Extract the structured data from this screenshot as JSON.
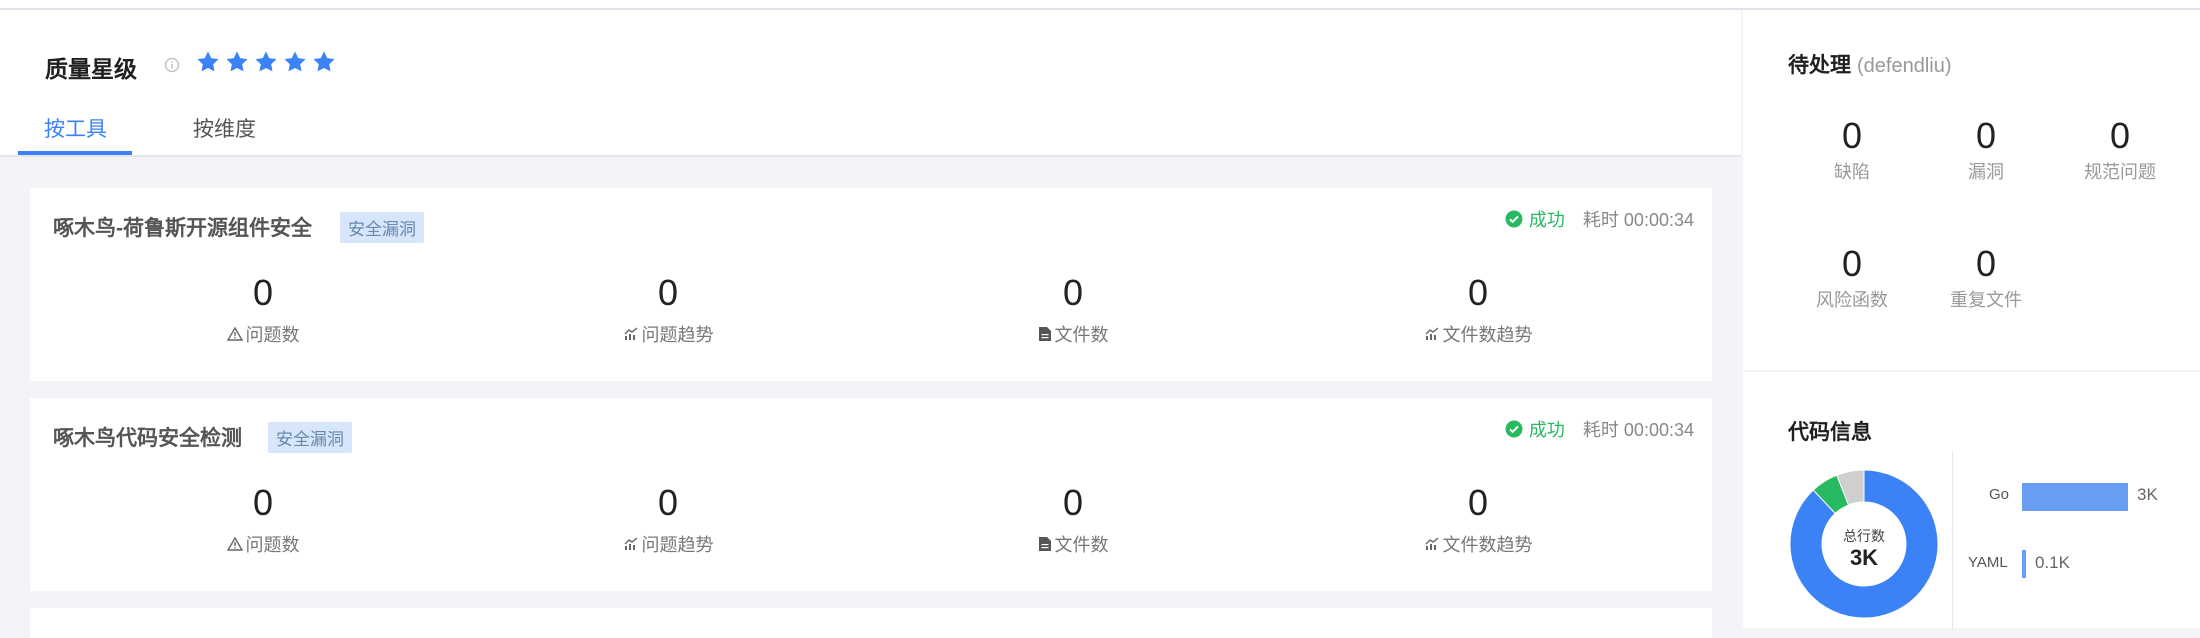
{
  "header": {
    "title": "质量星级",
    "stars": 5,
    "tabs": [
      "按工具",
      "按维度"
    ],
    "active_tab": 0
  },
  "cards": [
    {
      "title": "啄木鸟-荷鲁斯开源组件安全",
      "tag": "安全漏洞",
      "status": "成功",
      "time": "耗时 00:00:34",
      "metrics": [
        {
          "value": "0",
          "label": "问题数",
          "icon": "warning-icon"
        },
        {
          "value": "0",
          "label": "问题趋势",
          "icon": "trend-chart-icon"
        },
        {
          "value": "0",
          "label": "文件数",
          "icon": "file-icon"
        },
        {
          "value": "0",
          "label": "文件数趋势",
          "icon": "trend-chart-icon"
        }
      ]
    },
    {
      "title": "啄木鸟代码安全检测",
      "tag": "安全漏洞",
      "status": "成功",
      "time": "耗时 00:00:34",
      "metrics": [
        {
          "value": "0",
          "label": "问题数",
          "icon": "warning-icon"
        },
        {
          "value": "0",
          "label": "问题趋势",
          "icon": "trend-chart-icon"
        },
        {
          "value": "0",
          "label": "文件数",
          "icon": "file-icon"
        },
        {
          "value": "0",
          "label": "文件数趋势",
          "icon": "trend-chart-icon"
        }
      ]
    }
  ],
  "pending": {
    "title": "待处理",
    "user": "(defendliu)",
    "items": [
      {
        "value": "0",
        "label": "缺陷"
      },
      {
        "value": "0",
        "label": "漏洞"
      },
      {
        "value": "0",
        "label": "规范问题"
      },
      {
        "value": "0",
        "label": "风险函数"
      },
      {
        "value": "0",
        "label": "重复文件"
      }
    ]
  },
  "code_info": {
    "title": "代码信息",
    "total_label": "总行数",
    "total_value": "3K",
    "languages": [
      {
        "name": "Go",
        "value": "3K"
      },
      {
        "name": "YAML",
        "value": "0.1K"
      }
    ]
  },
  "chart_data": {
    "type": "pie",
    "title": "",
    "slices": [
      {
        "label": "Go",
        "share": 0.88,
        "color": "#3b82f6"
      },
      {
        "label": "",
        "share": 0.06,
        "color": "#27ba61"
      },
      {
        "label": "",
        "share": 0.06,
        "color": "#cfcfcf"
      }
    ]
  },
  "colors": {
    "accent": "#3b82f6",
    "success": "#27ba61",
    "star": "#3b82f6"
  }
}
